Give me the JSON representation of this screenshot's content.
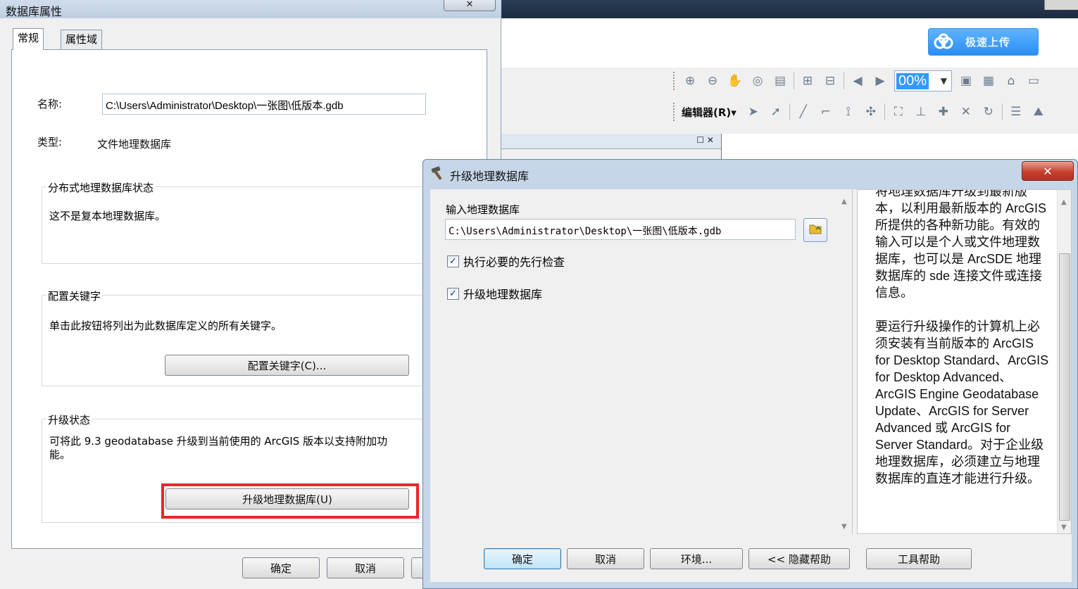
{
  "background_app": {
    "cloud_button_label": "极速上传",
    "zoom_value": "00%",
    "editor_menu": "编辑器(R)▾"
  },
  "props_dialog": {
    "title": "数据库属性",
    "close_glyph": "✕",
    "tabs": [
      "常规",
      "属性域"
    ],
    "name_label": "名称:",
    "name_value": "C:\\Users\\Administrator\\Desktop\\一张图\\低版本.gdb",
    "type_label": "类型:",
    "type_value": "文件地理数据库",
    "distributed": {
      "title": "分布式地理数据库状态",
      "text": "这不是复本地理数据库。"
    },
    "keywords": {
      "title": "配置关键字",
      "text": "单击此按钮将列出为此数据库定义的所有关键字。",
      "button": "配置关键字(C)..."
    },
    "upgrade": {
      "title": "升级状态",
      "text": "可将此 9.3 geodatabase 升级到当前使用的 ArcGIS 版本以支持附加功能。",
      "button": "升级地理数据库(U)"
    },
    "footer": {
      "ok": "确定",
      "cancel": "取消"
    }
  },
  "tool_dialog": {
    "title": "升级地理数据库",
    "close_glyph": "✕",
    "input_label": "输入地理数据库",
    "input_value": "C:\\Users\\Administrator\\Desktop\\一张图\\低版本.gdb",
    "checks": [
      {
        "label": "执行必要的先行检查",
        "checked": true
      },
      {
        "label": "升级地理数据库",
        "checked": true
      }
    ],
    "help": [
      "将地理数据库升级到最新版本，以利用最新版本的 ArcGIS 所提供的各种新功能。有效的输入可以是个人或文件地理数据库，也可以是 ArcSDE 地理数据库的 sde 连接文件或连接信息。",
      "要运行升级操作的计算机上必须安装有当前版本的 ArcGIS for Desktop Standard、ArcGIS for Desktop Advanced、ArcGIS Engine Geodatabase Update、ArcGIS for Server Advanced 或 ArcGIS for Server Standard。对于企业级地理数据库，必须建立与地理数据库的直连才能进行升级。"
    ],
    "footer": {
      "ok": "确定",
      "cancel": "取消",
      "env": "环境...",
      "hide_help": "<< 隐藏帮助",
      "tool_help": "工具帮助"
    }
  },
  "colors": {
    "highlight": "#e8262b",
    "accent": "#3399ff"
  }
}
